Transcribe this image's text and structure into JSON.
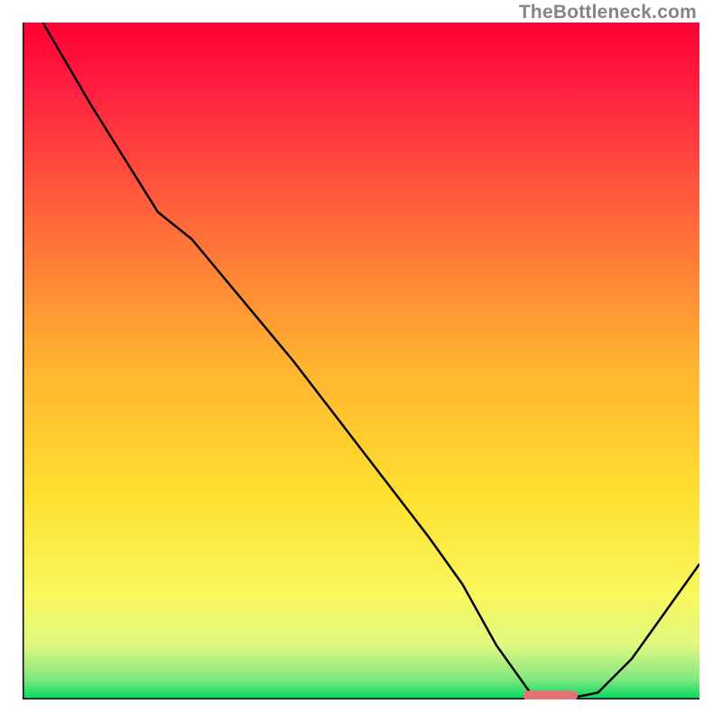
{
  "watermark": "TheBottleneck.com",
  "chart_data": {
    "type": "line",
    "title": "",
    "xlabel": "",
    "ylabel": "",
    "xlim": [
      0,
      100
    ],
    "ylim": [
      0,
      100
    ],
    "x": [
      3,
      10,
      20,
      25,
      30,
      40,
      50,
      60,
      65,
      70,
      75,
      80,
      85,
      90,
      100
    ],
    "values": [
      100,
      88,
      72,
      68,
      62,
      50,
      37,
      24,
      17,
      8,
      1,
      0,
      1,
      6,
      20
    ],
    "marker": {
      "x_start": 74,
      "x_end": 82,
      "y": 0.5
    },
    "background_gradient": {
      "stops": [
        {
          "pos": 0.0,
          "color": "#ff0033"
        },
        {
          "pos": 0.1,
          "color": "#ff2040"
        },
        {
          "pos": 0.3,
          "color": "#ff6a3a"
        },
        {
          "pos": 0.5,
          "color": "#ffb230"
        },
        {
          "pos": 0.7,
          "color": "#ffe030"
        },
        {
          "pos": 0.85,
          "color": "#f8f860"
        },
        {
          "pos": 0.92,
          "color": "#e0f880"
        },
        {
          "pos": 0.97,
          "color": "#80e880"
        },
        {
          "pos": 1.0,
          "color": "#00d860"
        }
      ]
    }
  }
}
